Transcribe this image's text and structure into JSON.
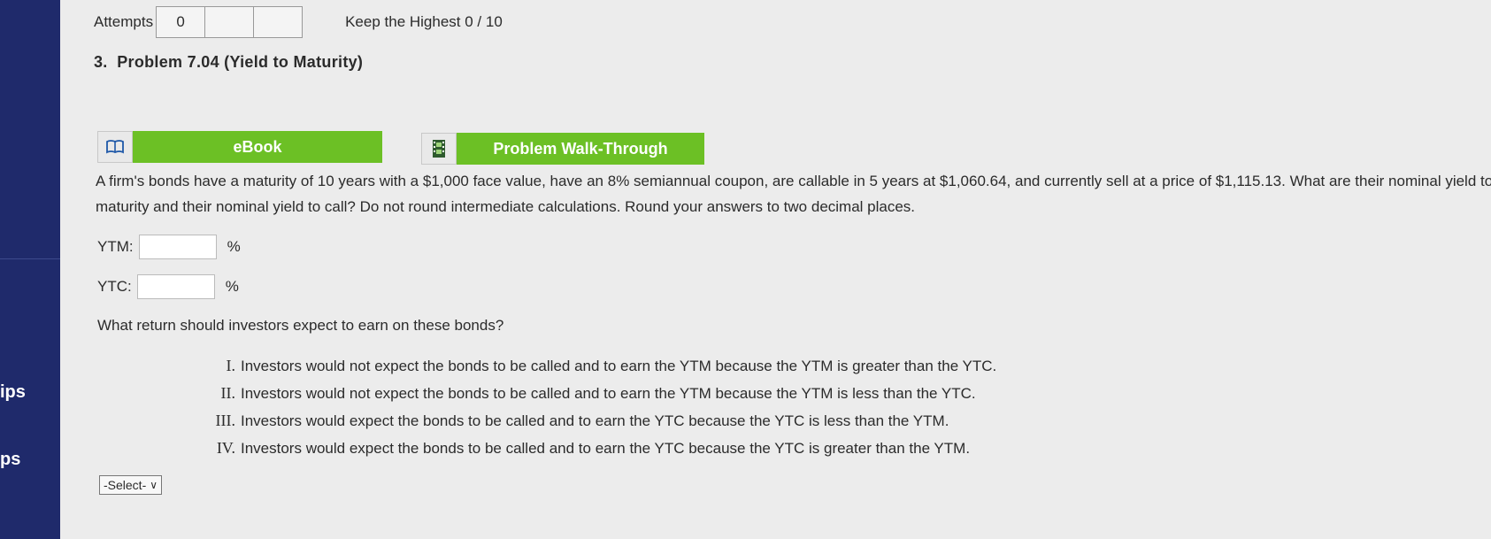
{
  "sidebar": {
    "items": [
      "ips",
      "ps"
    ]
  },
  "attempts": {
    "label": "Attempts",
    "values": [
      "0",
      "",
      ""
    ]
  },
  "keep_highest": "Keep the Highest 0 / 10",
  "problem": {
    "number": "3.",
    "title": "Problem 7.04 (Yield to Maturity)"
  },
  "resources": {
    "ebook": "eBook",
    "walkthrough": "Problem Walk-Through"
  },
  "question_text": "A firm's bonds have a maturity of 10 years with a $1,000 face value, have an 8% semiannual coupon, are callable in 5 years at $1,060.64, and currently sell at a price of $1,115.13. What are their nominal yield to maturity and their nominal yield to call? Do not round intermediate calculations. Round your answers to two decimal places.",
  "answers": [
    {
      "label": "YTM:",
      "value": "",
      "unit": "%"
    },
    {
      "label": "YTC:",
      "value": "",
      "unit": "%"
    }
  ],
  "question2": "What return should investors expect to earn on these bonds?",
  "options": [
    {
      "num": "I.",
      "text": "Investors would not expect the bonds to be called and to earn the YTM because the YTM is greater than the YTC."
    },
    {
      "num": "II.",
      "text": "Investors would not expect the bonds to be called and to earn the YTM because the YTM is less than the YTC."
    },
    {
      "num": "III.",
      "text": "Investors would expect the bonds to be called and to earn the YTC because the YTC is less than the YTM."
    },
    {
      "num": "IV.",
      "text": "Investors would expect the bonds to be called and to earn the YTC because the YTC is greater than the YTM."
    }
  ],
  "select": {
    "value": "-Select-"
  },
  "colors": {
    "sidebar": "#1f2a6b",
    "accent_green": "#6cc025"
  }
}
